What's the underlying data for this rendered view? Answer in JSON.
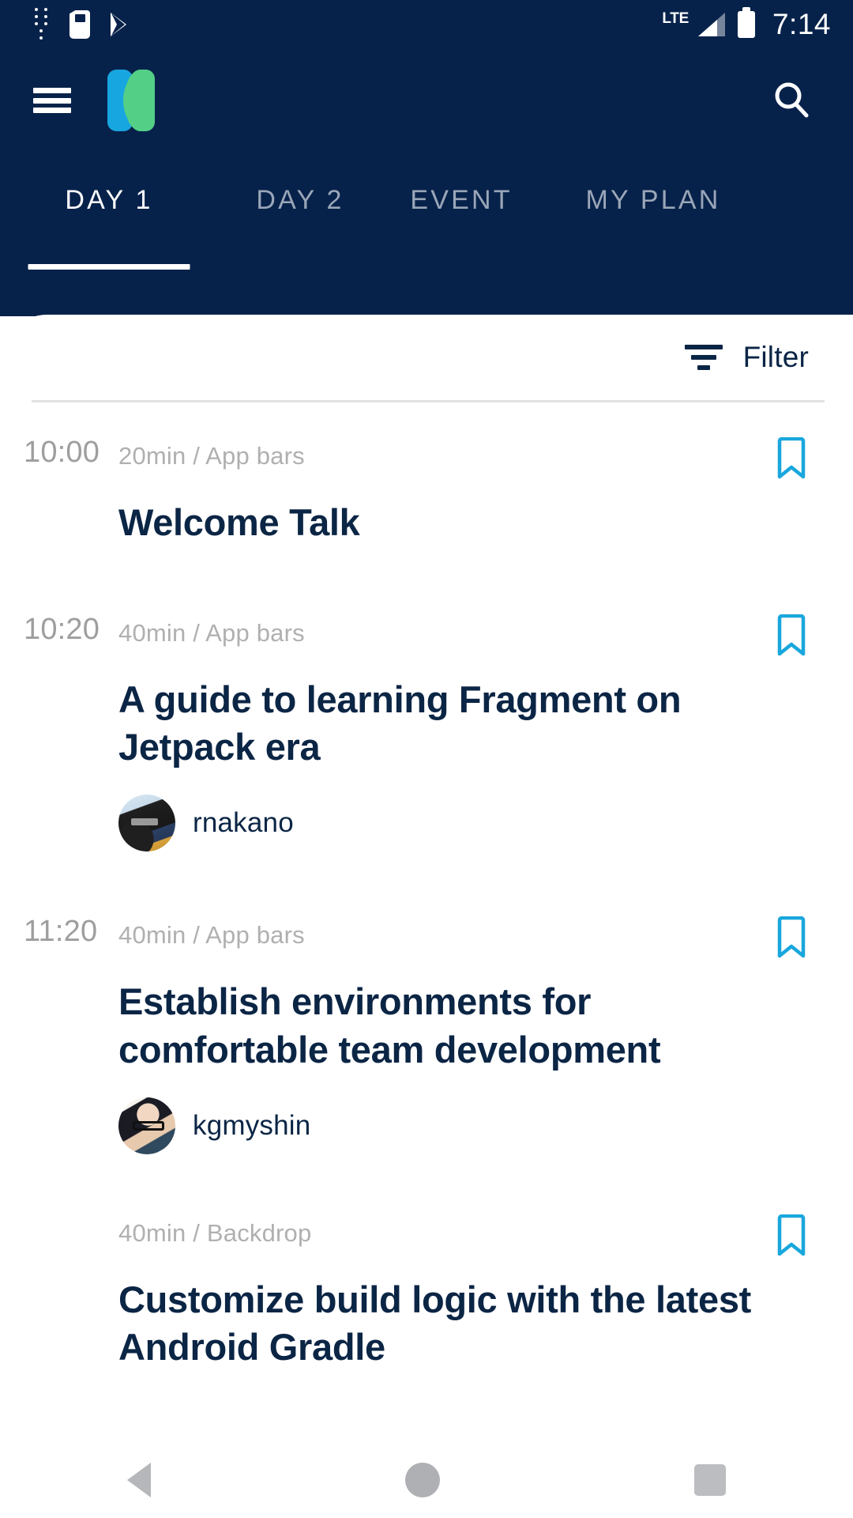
{
  "status_bar": {
    "icons": [
      "vertical-dots-icon",
      "sd-card-icon",
      "play-store-icon"
    ],
    "network_label": "LTE",
    "time": "7:14"
  },
  "app_bar": {
    "menu_label": "menu",
    "logo_label": "DroidKaigi",
    "search_label": "search"
  },
  "tabs": [
    {
      "label": "DAY 1",
      "active": true
    },
    {
      "label": "DAY 2",
      "active": false
    },
    {
      "label": "EVENT",
      "active": false
    },
    {
      "label": "MY PLAN",
      "active": false
    }
  ],
  "toolbar": {
    "filter_label": "Filter"
  },
  "colors": {
    "app_bar_bg": "#07224a",
    "accent_bookmark": "#19a7dd",
    "title_text": "#0b2545",
    "meta_text": "#b0b0b0",
    "time_text": "#9e9e9e",
    "tab_inactive": "#9aa6b8",
    "logo_blue": "#18a6e0",
    "logo_green": "#53cf86"
  },
  "sessions": [
    {
      "time": "10:00",
      "meta": "20min / App bars",
      "title": "Welcome Talk",
      "speaker": null,
      "bookmarked": false
    },
    {
      "time": "10:20",
      "meta": "40min / App bars",
      "title": "A guide to learning Fragment on Jetpack era",
      "speaker": "rnakano",
      "bookmarked": false
    },
    {
      "time": "11:20",
      "meta": "40min / App bars",
      "title": "Establish environments for comfortable team development",
      "speaker": "kgmyshin",
      "bookmarked": false
    },
    {
      "time": "",
      "meta": "40min / Backdrop",
      "title": "Customize build logic with the latest Android Gradle",
      "speaker": null,
      "bookmarked": false
    }
  ],
  "nav_bar": {
    "back_label": "back",
    "home_label": "home",
    "recents_label": "recents"
  }
}
